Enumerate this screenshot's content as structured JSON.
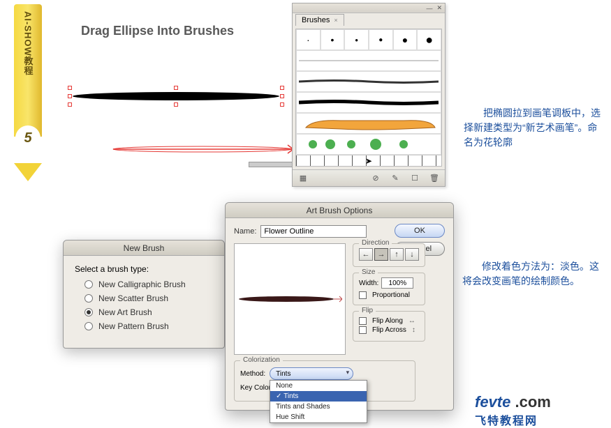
{
  "bookmark": {
    "text": "AI-SHOW教程",
    "num": "5"
  },
  "headline": "Drag Ellipse Into Brushes",
  "brushes_panel": {
    "tab": "Brushes",
    "calligraphic": [
      "·",
      "•",
      "●",
      "●",
      "●",
      "●"
    ],
    "footer_icons": [
      "lib-icon",
      "remove-stroke-icon",
      "brush-options-icon",
      "new-brush-icon",
      "trash-icon"
    ]
  },
  "cn1": "　　把椭圆拉到画笔调板中，选择新建类型为“新艺术画笔”。命名为花轮廓",
  "cn2": "　　修改着色方法为：淡色。这将会改变画笔的绘制颜色。",
  "brand": {
    "big": "fevte",
    "com": " .com",
    "sub": "飞特教程网"
  },
  "new_brush": {
    "title": "New Brush",
    "label": "Select a brush type:",
    "options": [
      "New Calligraphic Brush",
      "New Scatter Brush",
      "New Art Brush",
      "New Pattern Brush"
    ],
    "selected": 2
  },
  "art_brush": {
    "title": "Art Brush Options",
    "name_label": "Name:",
    "name_value": "Flower Outline",
    "ok": "OK",
    "cancel": "Cancel",
    "direction": {
      "title": "Direction",
      "btns": [
        "←",
        "→",
        "↑",
        "↓"
      ],
      "sel": 1
    },
    "size": {
      "title": "Size",
      "width_label": "Width:",
      "width_value": "100%",
      "proportional": "Proportional"
    },
    "flip": {
      "title": "Flip",
      "along": "Flip Along",
      "across": "Flip Across"
    },
    "colorization": {
      "title": "Colorization",
      "method_label": "Method:",
      "key_label": "Key Color:",
      "options": [
        "None",
        "Tints",
        "Tints and Shades",
        "Hue Shift"
      ],
      "selected": 1
    }
  }
}
